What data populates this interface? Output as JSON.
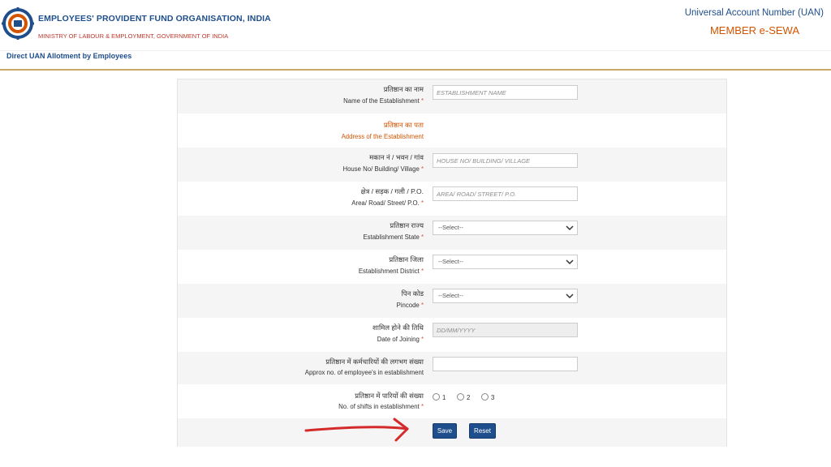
{
  "header": {
    "org_name": "EMPLOYEES' PROVIDENT FUND ORGANISATION, INDIA",
    "ministry": "MINISTRY OF LABOUR & EMPLOYMENT, GOVERNMENT OF INDIA",
    "uan_title": "Universal Account Number (UAN)",
    "portal": "MEMBER e-SEWA"
  },
  "page_title": "Direct UAN Allotment by Employees",
  "form": {
    "establishment_name": {
      "hi": "प्रतिष्ठान का नाम",
      "en": "Name of the Establishment",
      "placeholder": "ESTABLISHMENT NAME"
    },
    "address_section": {
      "hi": "प्रतिष्ठान का पता",
      "en": "Address of the Establishment"
    },
    "house": {
      "hi": "मकान नं / भवन / गांव",
      "en": "House No/ Building/ Village",
      "placeholder": "HOUSE NO/ BUILDING/ VILLAGE"
    },
    "area": {
      "hi": "क्षेत्र / सड़क / गली / P.O.",
      "en": "Area/ Road/ Street/ P.O.",
      "placeholder": "AREA/ ROAD/ STREET/ P.O."
    },
    "state": {
      "hi": "प्रतिष्ठान राज्य",
      "en": "Establishment State",
      "value": "--Select--"
    },
    "district": {
      "hi": "प्रतिष्ठान जिला",
      "en": "Establishment District",
      "value": "--Select--"
    },
    "pincode": {
      "hi": "पिन कोड",
      "en": "Pincode",
      "value": "--Select--"
    },
    "joining": {
      "hi": "शामिल होने की तिथि",
      "en": "Date of Joining",
      "placeholder": "DD/MM/YYYY"
    },
    "employees": {
      "hi": "प्रतिष्ठान में कर्मचारियों की लगभग संख्या",
      "en": "Approx no. of employee's in establishment",
      "value": ""
    },
    "shifts": {
      "hi": "प्रतिष्ठान में पारियों की संख्या",
      "en": "No. of shifts in establishment",
      "options": [
        "1",
        "2",
        "3"
      ]
    },
    "required_mark": "*"
  },
  "buttons": {
    "save": "Save",
    "reset": "Reset"
  },
  "colors": {
    "primary": "#1f4e8c",
    "accent": "#d35400",
    "arrow": "#d42a2a"
  }
}
